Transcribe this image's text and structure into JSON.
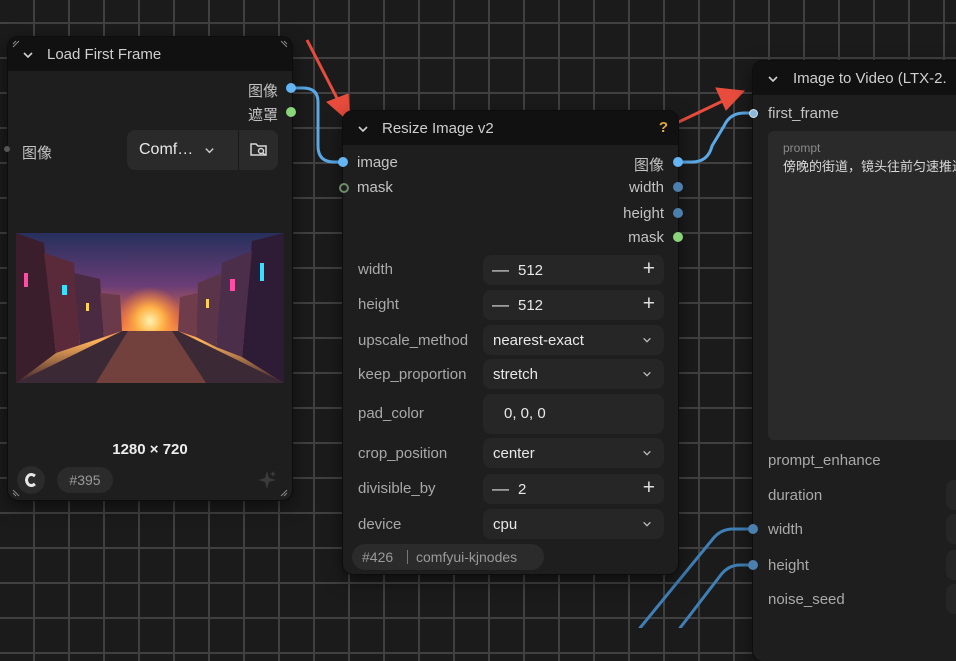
{
  "colors": {
    "canvas_bg": "#1b1b1b",
    "node_bg": "#1e1e1e",
    "header_bg": "#111111",
    "socket_image": "#64b5f6",
    "socket_mask": "#8ad47a",
    "socket_int": "#4b7fae",
    "link_blue": "#5aa9e6",
    "arrow_red": "#e74c3c",
    "help_yellow": "#e2a93b"
  },
  "load_node": {
    "title": "Load First Frame",
    "outputs": [
      "图像",
      "遮罩"
    ],
    "widget_label": "图像",
    "combo_value": "Comf…",
    "image_size": "1280 × 720",
    "node_id": "#395"
  },
  "resize_node": {
    "title": "Resize Image v2",
    "help": "?",
    "inputs": [
      "image",
      "mask"
    ],
    "outputs": [
      "图像",
      "width",
      "height",
      "mask"
    ],
    "widgets": {
      "width": {
        "label": "width",
        "value": "512"
      },
      "height": {
        "label": "height",
        "value": "512"
      },
      "upscale_method": {
        "label": "upscale_method",
        "value": "nearest-exact"
      },
      "keep_proportion": {
        "label": "keep_proportion",
        "value": "stretch"
      },
      "pad_color": {
        "label": "pad_color",
        "value": "0, 0, 0"
      },
      "crop_position": {
        "label": "crop_position",
        "value": "center"
      },
      "divisible_by": {
        "label": "divisible_by",
        "value": "2"
      },
      "device": {
        "label": "device",
        "value": "cpu"
      }
    },
    "node_id": "#426",
    "package": "comfyui-kjnodes"
  },
  "video_node": {
    "title": "Image to Video (LTX-2.",
    "inputs": [
      "first_frame"
    ],
    "prompt_label": "prompt",
    "prompt_text": "傍晚的街道，镜头往前匀速推进",
    "widgets": [
      "prompt_enhance",
      "duration",
      "width",
      "height",
      "noise_seed"
    ]
  }
}
